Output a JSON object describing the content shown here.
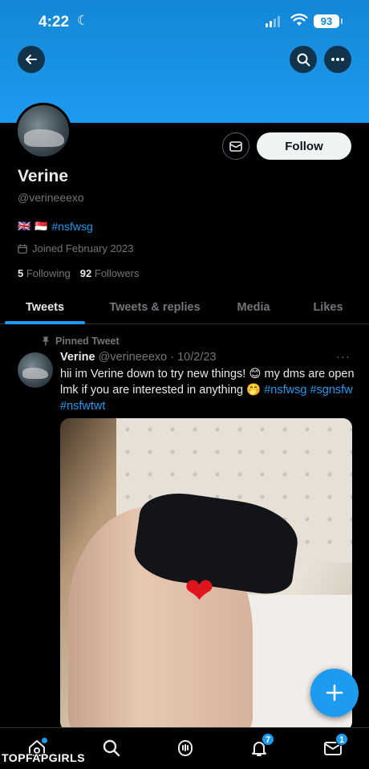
{
  "status_bar": {
    "time": "4:22",
    "battery": "93"
  },
  "profile": {
    "display_name": "Verine",
    "handle": "@verineeexo",
    "bio_hashtag": "#nsfwsg",
    "joined": "Joined February 2023",
    "following_count": "5",
    "following_label": "Following",
    "followers_count": "92",
    "followers_label": "Followers",
    "follow_button": "Follow"
  },
  "tabs": [
    {
      "label": "Tweets",
      "active": true
    },
    {
      "label": "Tweets & replies",
      "active": false
    },
    {
      "label": "Media",
      "active": false
    },
    {
      "label": "Likes",
      "active": false
    }
  ],
  "tweet": {
    "pinned_label": "Pinned Tweet",
    "name": "Verine",
    "handle_date": "@verineeexo · 10/2/23",
    "text_part1": "hii im Verine down to try new things! ",
    "text_part2": " my dms are open lmk if you are interested in anything ",
    "hashtags_inline": "#nsfwsg",
    "hashtags_line2": "#sgnsfw #nsfwtwt"
  },
  "nav": {
    "notifications_badge": "7",
    "messages_badge": "1"
  },
  "watermark": "TOPFAPGIRLS",
  "colors": {
    "accent": "#1d9bf0",
    "background": "#000000",
    "banner": "#1d9bf0"
  }
}
